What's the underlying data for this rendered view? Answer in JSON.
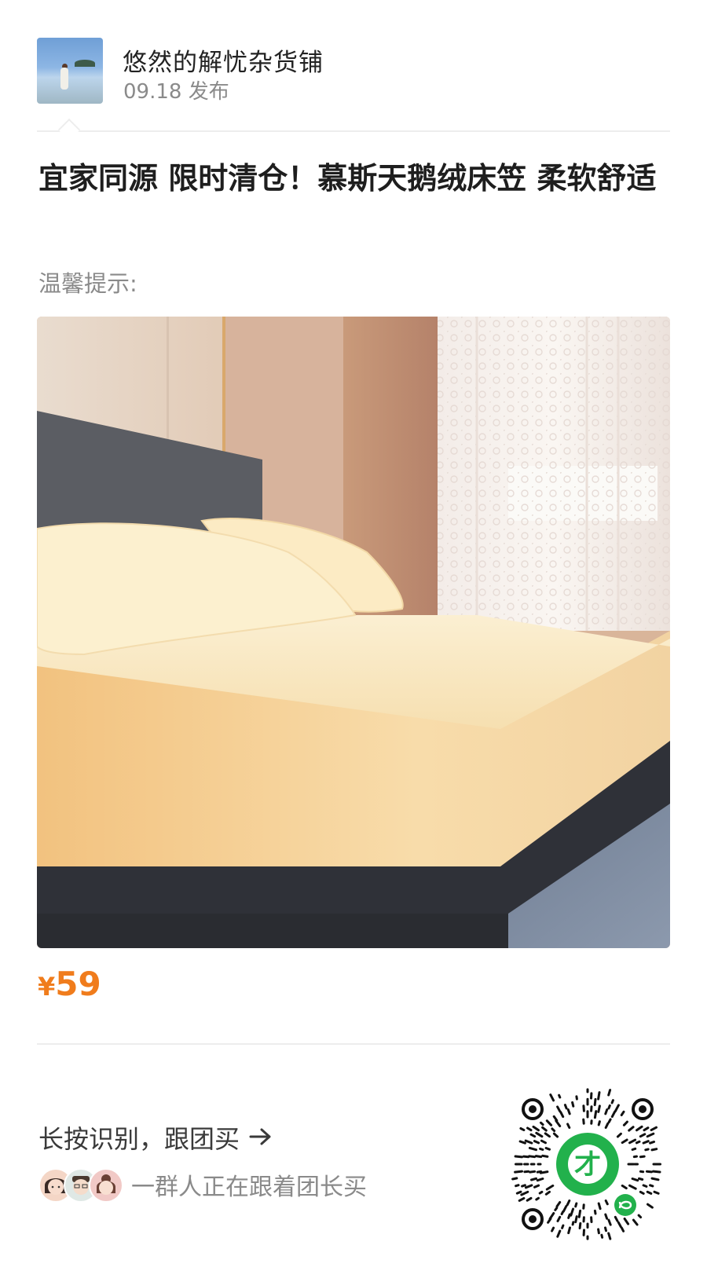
{
  "header": {
    "shop_name": "悠然的解忧杂货铺",
    "post_date": "09.18 发布"
  },
  "post": {
    "title": "宜家同源 限时清仓！慕斯天鹅绒床笠 柔软舒适",
    "tip": "温馨提示:",
    "price_symbol": "¥",
    "price_value": "59"
  },
  "footer": {
    "cta": "长按识别，跟团买",
    "followers_text": "一群人正在跟着团长买"
  },
  "colors": {
    "price": "#f07c1c",
    "qr_badge": "#22b14c"
  },
  "icons": [
    "arrow-right-icon",
    "mini-program-icon",
    "qr-badge-icon"
  ]
}
